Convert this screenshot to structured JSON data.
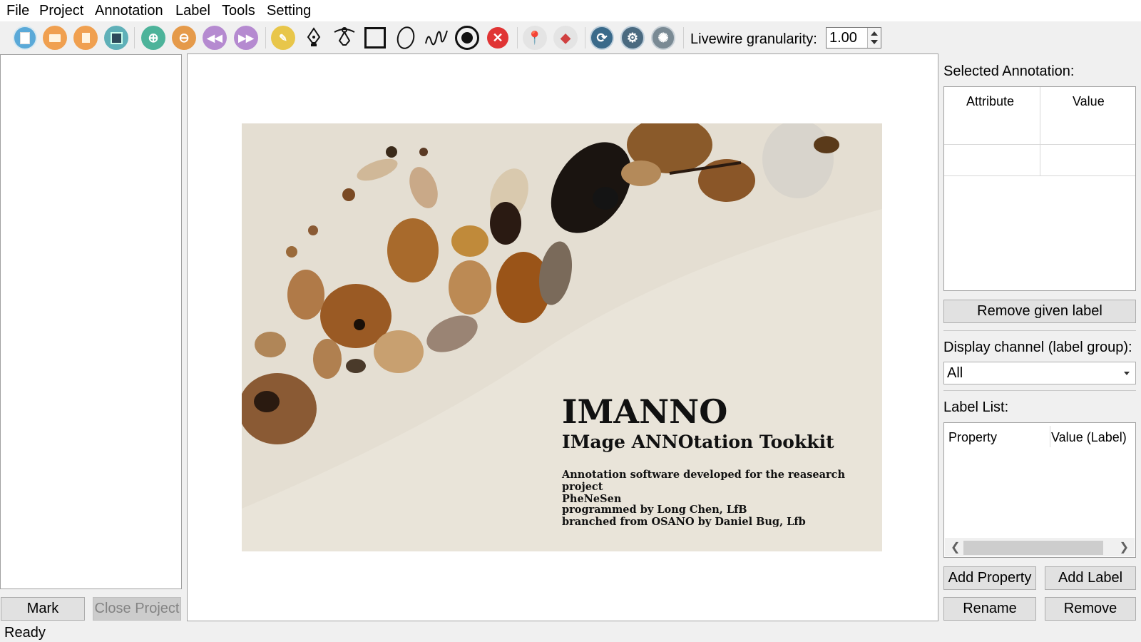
{
  "menu": [
    "File",
    "Project",
    "Annotation",
    "Label",
    "Tools",
    "Setting"
  ],
  "toolbar": {
    "icons": [
      "new-file-icon",
      "open-folder-icon",
      "document-icon",
      "save-icon",
      "zoom-in-icon",
      "zoom-out-icon",
      "previous-icon",
      "next-icon",
      "paint-icon",
      "pen-icon",
      "livewire-icon",
      "rectangle-icon",
      "ellipse-icon",
      "freehand-icon",
      "point-icon",
      "delete-icon",
      "pin-icon",
      "tag-icon",
      "refresh-icon",
      "settings-icon",
      "aperture-icon"
    ],
    "livewire_label": "Livewire granularity:",
    "livewire_value": "1.00"
  },
  "left": {
    "mark_button": "Mark",
    "close_project_button": "Close Project"
  },
  "status": "Ready",
  "splash": {
    "title": "IMANNO",
    "subtitle": "IMage ANNOtation Tookkit",
    "description_line1": "Annotation software developed for the reasearch project",
    "description_line2": "PheNeSen",
    "credits_line1": "programmed by Long Chen, LfB",
    "credits_line2": "branched from OSANO by Daniel Bug, Lfb"
  },
  "right": {
    "selected_annotation_label": "Selected Annotation:",
    "attr_headers": [
      "Attribute",
      "Value"
    ],
    "remove_given_label_button": "Remove given label",
    "display_channel_label": "Display channel (label group):",
    "display_channel_value": "All",
    "label_list_label": "Label List:",
    "label_headers": [
      "Property",
      "Value (Label)"
    ],
    "add_property_button": "Add Property",
    "add_label_button": "Add Label",
    "rename_button": "Rename",
    "remove_button": "Remove"
  }
}
